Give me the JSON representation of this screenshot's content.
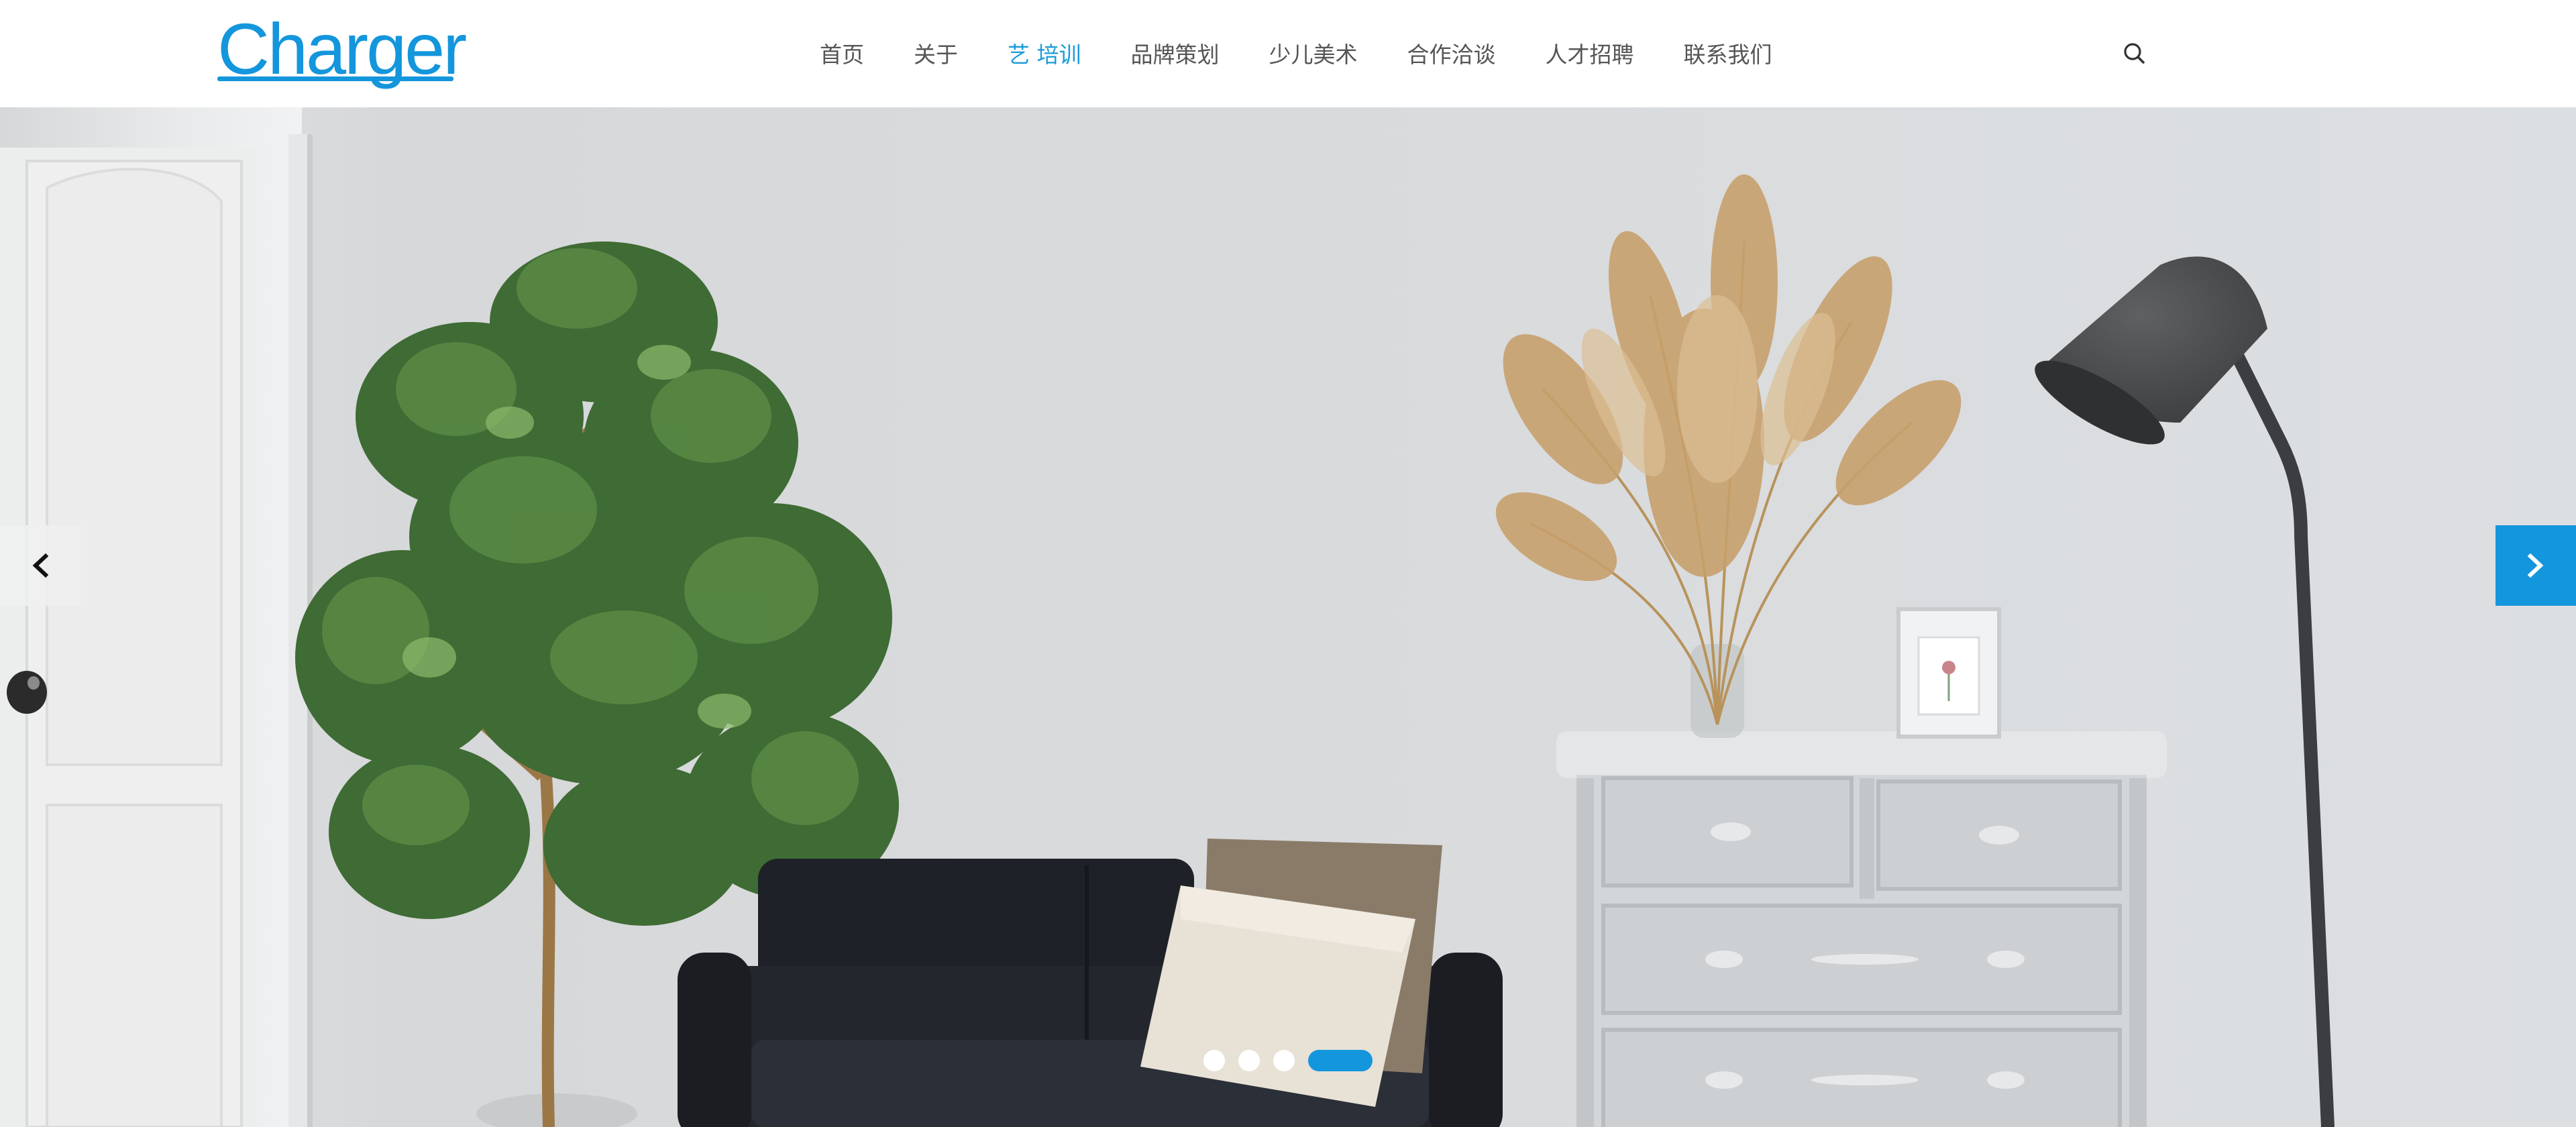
{
  "header": {
    "logo_text": "Charger",
    "brand_color": "#1496dc",
    "nav_items": [
      {
        "label": "首页",
        "active": false
      },
      {
        "label": "关于",
        "active": false
      },
      {
        "label": "艺 培训",
        "active": true
      },
      {
        "label": "品牌策划",
        "active": false
      },
      {
        "label": "少儿美术",
        "active": false
      },
      {
        "label": "合作洽谈",
        "active": false
      },
      {
        "label": "人才招聘",
        "active": false
      },
      {
        "label": "联系我们",
        "active": false
      }
    ],
    "search_icon": "search-icon"
  },
  "hero": {
    "prev_icon": "chevron-left-icon",
    "next_icon": "chevron-right-icon",
    "slide_count": 4,
    "active_slide": 4
  },
  "colors": {
    "accent": "#1496dc",
    "nav_text": "#555555",
    "wall": "#d7d9db"
  }
}
